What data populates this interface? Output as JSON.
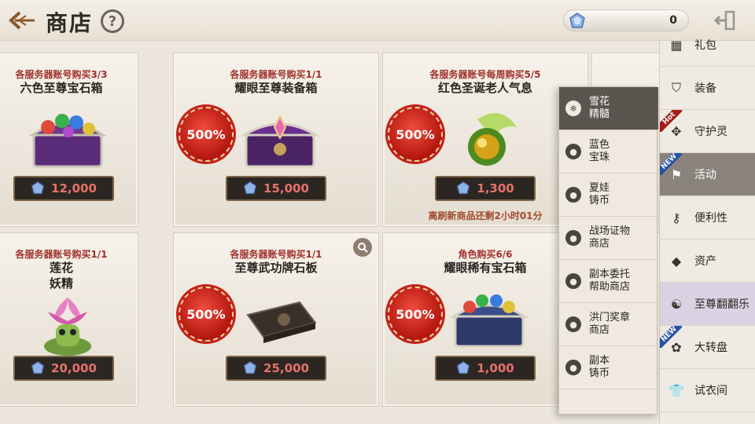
{
  "header": {
    "title": "商店",
    "help_label": "?",
    "currency_value": "0"
  },
  "cards": [
    {
      "limit": "各服务器账号购买3/3",
      "name": "六色至尊宝石箱",
      "badge": "",
      "price": "12,000",
      "refresh": ""
    },
    {
      "limit": "各服务器账号购买1/1",
      "name": "耀眼至尊装备箱",
      "badge": "500%",
      "price": "15,000",
      "refresh": ""
    },
    {
      "limit": "各服务器账号每周购买5/5",
      "name": "红色圣诞老人气息",
      "badge": "500%",
      "price": "1,300",
      "refresh": "离刷新商品还剩2小时01分"
    },
    {
      "limit": "各服务器账号购买1/1",
      "name": "莲花\n妖精",
      "badge": "",
      "price": "20,000",
      "refresh": ""
    },
    {
      "limit": "各服务器账号购买1/1",
      "name": "至尊武功牌石板",
      "badge": "500%",
      "price": "25,000",
      "refresh": ""
    },
    {
      "limit": "角色购买6/6",
      "name": "耀眼稀有宝石箱",
      "badge": "500%",
      "price": "1,000",
      "refresh": ""
    }
  ],
  "submenu": [
    {
      "label": "雪花\n精髓",
      "active": true
    },
    {
      "label": "蓝色\n宝珠",
      "active": false
    },
    {
      "label": "夏娃\n铸币",
      "active": false
    },
    {
      "label": "战场证物\n商店",
      "active": false
    },
    {
      "label": "副本委托\n帮助商店",
      "active": false
    },
    {
      "label": "洪门奖章\n商店",
      "active": false
    },
    {
      "label": "副本\n铸币",
      "active": false
    }
  ],
  "sidebar": [
    {
      "label": "礼包",
      "icon": "gift-icon",
      "ribbon": ""
    },
    {
      "label": "装备",
      "icon": "armor-icon",
      "ribbon": ""
    },
    {
      "label": "守护灵",
      "icon": "paw-icon",
      "ribbon": "Hot"
    },
    {
      "label": "活动",
      "icon": "flag-icon",
      "ribbon": "NEW"
    },
    {
      "label": "便利性",
      "icon": "key-icon",
      "ribbon": ""
    },
    {
      "label": "资产",
      "icon": "crystal-icon",
      "ribbon": ""
    },
    {
      "label": "至尊翻翻乐",
      "icon": "mask-icon",
      "ribbon": ""
    },
    {
      "label": "大转盘",
      "icon": "wheel-icon",
      "ribbon": "NEW"
    },
    {
      "label": "试衣间",
      "icon": "shirt-icon",
      "ribbon": ""
    }
  ],
  "colors": {
    "accent_red": "#b3170f",
    "price_text": "#e2736a",
    "active_menu": "#5b554f"
  }
}
